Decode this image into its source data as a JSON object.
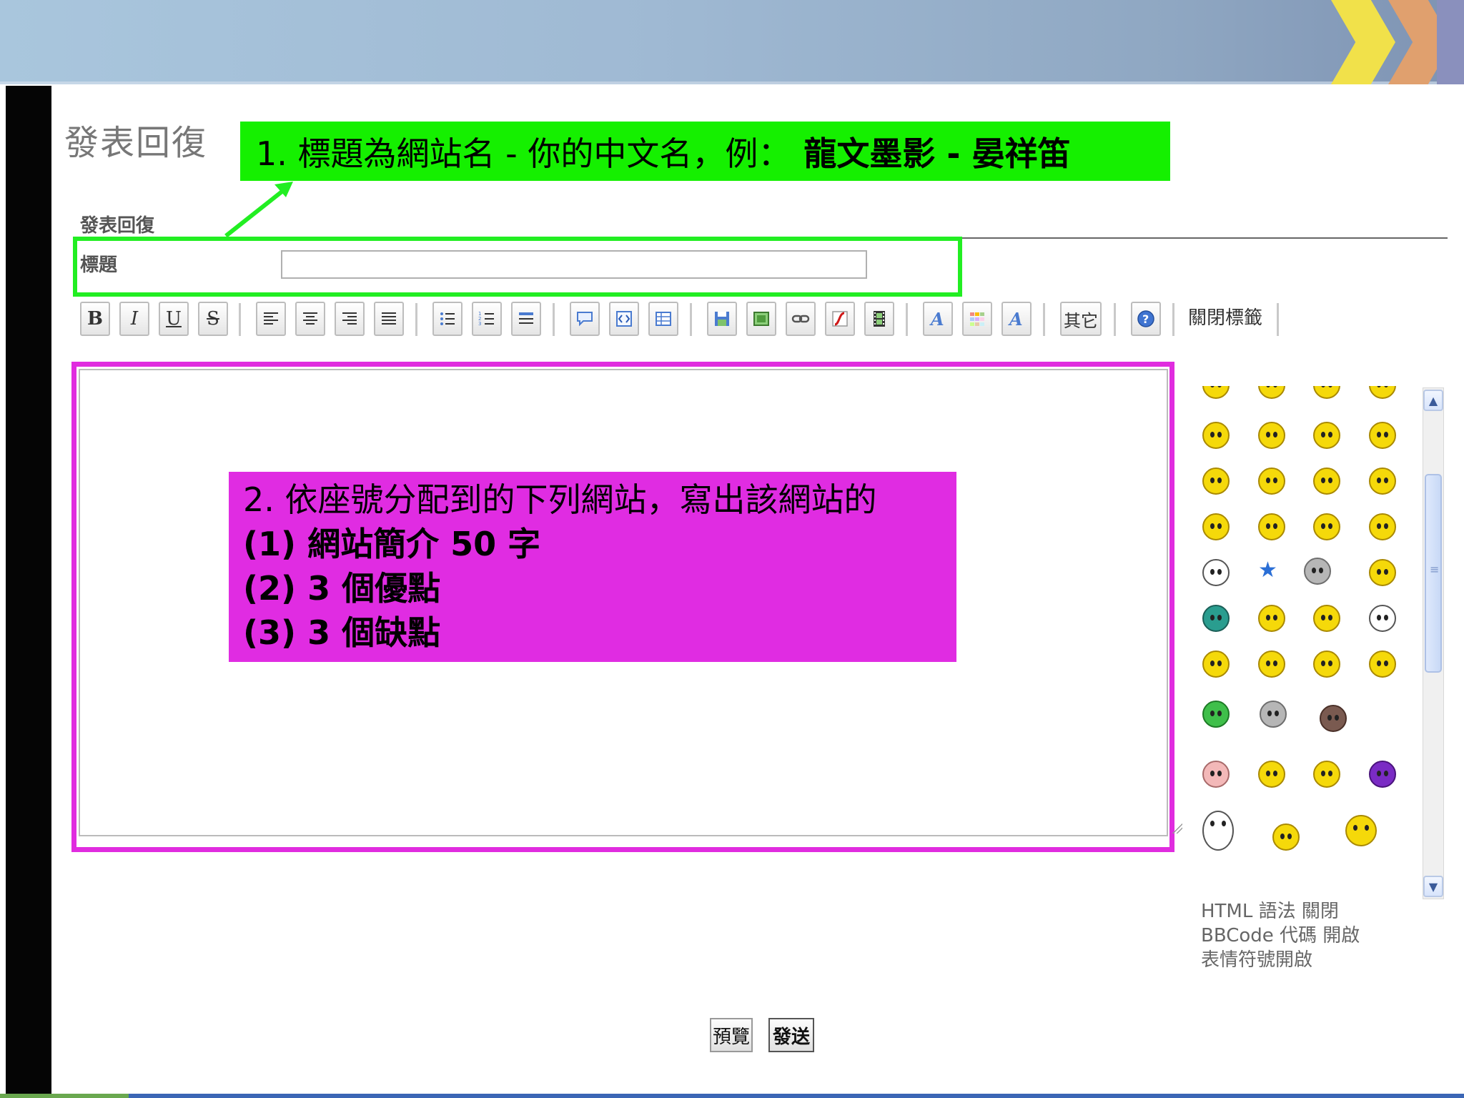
{
  "page": {
    "heading": "發表回復",
    "section_label": "發表回復",
    "subject_label": "標題",
    "subject_value": ""
  },
  "toolbar": {
    "bold": "B",
    "italic": "I",
    "underline": "U",
    "strike": "S",
    "more_label": "其它",
    "close_tags_label": "關閉標籤"
  },
  "callouts": {
    "title_hint_prefix": "1.  標題為網站名 - 你的中文名，例：",
    "title_hint_example": "龍文墨影 - 晏祥笛",
    "content_hint_line1": "2. 依座號分配到的下列網站，寫出該網站的",
    "content_hint_line2": "(1)  網站簡介 50 字",
    "content_hint_line3": "(2) 3 個優點",
    "content_hint_line4": "(3) 3 個缺點"
  },
  "status": {
    "html": "HTML 語法 關閉",
    "bbcode": "BBCode 代碼 開啟",
    "smilies": "表情符號開啟"
  },
  "buttons": {
    "preview": "預覽",
    "submit": "發送"
  },
  "colors": {
    "callout_green": "#15f000",
    "callout_magenta": "#e02ce2",
    "frame_green": "#22ee22",
    "frame_magenta": "#e02cdf"
  }
}
